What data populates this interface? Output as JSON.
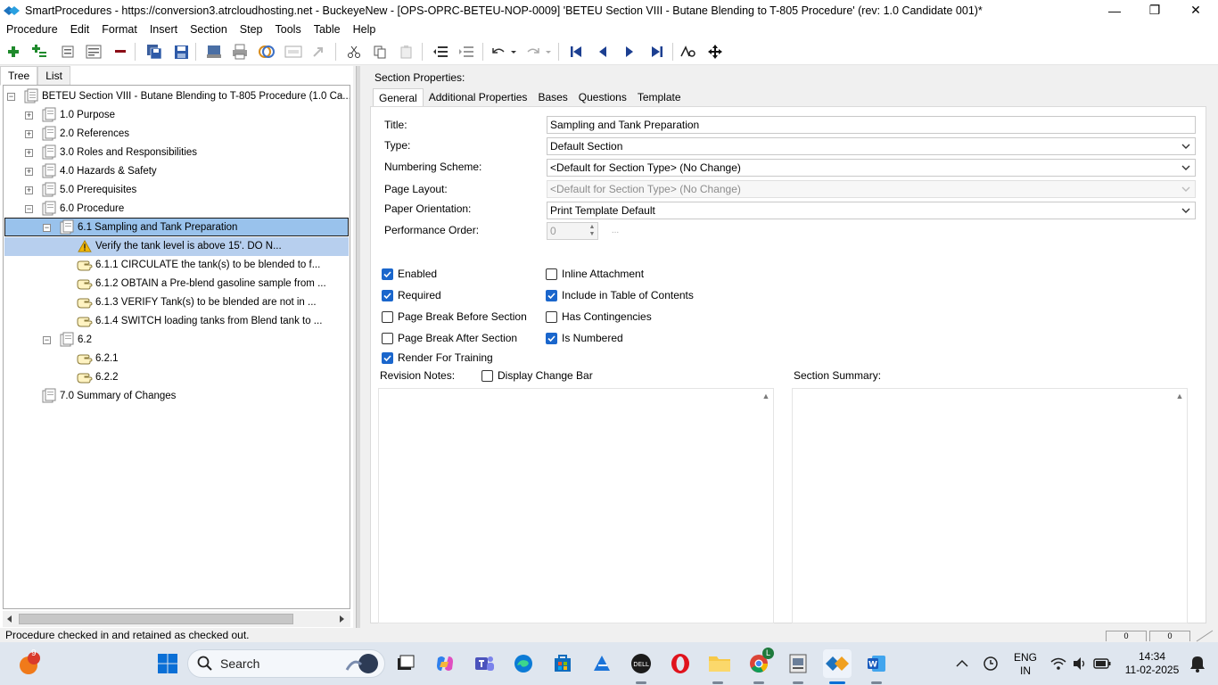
{
  "window": {
    "title": "SmartProcedures - https://conversion3.atrcloudhosting.net - BuckeyeNew - [OPS-OPRC-BETEU-NOP-0009] 'BETEU Section VIII - Butane Blending to T-805 Procedure' (rev: 1.0 Candidate 001)*",
    "minimize": "—",
    "restore": "❐",
    "close": "✕"
  },
  "menu": [
    "Procedure",
    "Edit",
    "Format",
    "Insert",
    "Section",
    "Step",
    "Tools",
    "Table",
    "Help"
  ],
  "left_tabs": [
    "Tree",
    "List"
  ],
  "tree": {
    "root": "BETEU Section VIII - Butane Blending to T-805 Procedure (1.0 Ca...",
    "items": [
      {
        "label": "1.0 Purpose",
        "expander": "+"
      },
      {
        "label": "2.0 References",
        "expander": "+"
      },
      {
        "label": "3.0 Roles and Responsibilities",
        "expander": "+"
      },
      {
        "label": "4.0 Hazards & Safety",
        "expander": "+"
      },
      {
        "label": "5.0 Prerequisites",
        "expander": "+"
      },
      {
        "label": "6.0 Procedure",
        "expander": "−"
      },
      {
        "label": "6.1 Sampling and Tank Preparation",
        "expander": "−"
      },
      {
        "label": "Verify the tank level is above 15'. DO N..."
      },
      {
        "label": "6.1.1 CIRCULATE the tank(s) to be blended to f..."
      },
      {
        "label": "6.1.2 OBTAIN a Pre-blend gasoline sample from ..."
      },
      {
        "label": "6.1.3 VERIFY Tank(s) to be blended are not in ..."
      },
      {
        "label": "6.1.4 SWITCH loading tanks from Blend tank to ..."
      },
      {
        "label": "6.2",
        "expander": "−"
      },
      {
        "label": "6.2.1"
      },
      {
        "label": "6.2.2"
      },
      {
        "label": "7.0 Summary of Changes"
      }
    ],
    "root_expander": "−"
  },
  "section_properties": {
    "heading": "Section Properties:",
    "tabs": [
      "General",
      "Additional Properties",
      "Bases",
      "Questions",
      "Template"
    ],
    "fields": {
      "title_label": "Title:",
      "title_value": "Sampling and Tank Preparation",
      "type_label": "Type:",
      "type_value": "Default Section",
      "numbering_label": "Numbering Scheme:",
      "numbering_value": "<Default for Section Type> (No Change)",
      "layout_label": "Page Layout:",
      "layout_value": "<Default for Section Type> (No Change)",
      "orientation_label": "Paper Orientation:",
      "orientation_value": "Print Template Default",
      "perf_label": "Performance Order:",
      "perf_value": "0",
      "perf_browse": "..."
    },
    "checkboxes": {
      "enabled": {
        "label": "Enabled",
        "checked": true
      },
      "required": {
        "label": "Required",
        "checked": true
      },
      "page_break_before": {
        "label": "Page Break Before Section",
        "checked": false
      },
      "page_break_after": {
        "label": "Page Break After Section",
        "checked": false
      },
      "render_training": {
        "label": "Render For Training",
        "checked": true
      },
      "inline_attachment": {
        "label": "Inline Attachment",
        "checked": false
      },
      "include_toc": {
        "label": "Include in Table of Contents",
        "checked": true
      },
      "has_contingencies": {
        "label": "Has Contingencies",
        "checked": false
      },
      "is_numbered": {
        "label": "Is Numbered",
        "checked": true
      },
      "display_change_bar": {
        "label": "Display Change Bar",
        "checked": false
      }
    },
    "revision_notes_label": "Revision Notes:",
    "section_summary_label": "Section Summary:"
  },
  "status": {
    "text": "Procedure checked in and retained as checked out.",
    "box1": "0",
    "box2": "0"
  },
  "taskbar": {
    "notification_badge": "9",
    "search_label": "Search",
    "chrome_badge": "L",
    "lang_line1": "ENG",
    "lang_line2": "IN",
    "time": "14:34",
    "date": "11-02-2025"
  },
  "colors": {
    "selection": "#99c2ec",
    "selection_dark": "#3399ff",
    "accent": "#1a66cc",
    "taskbar": "#dfe6ef"
  }
}
